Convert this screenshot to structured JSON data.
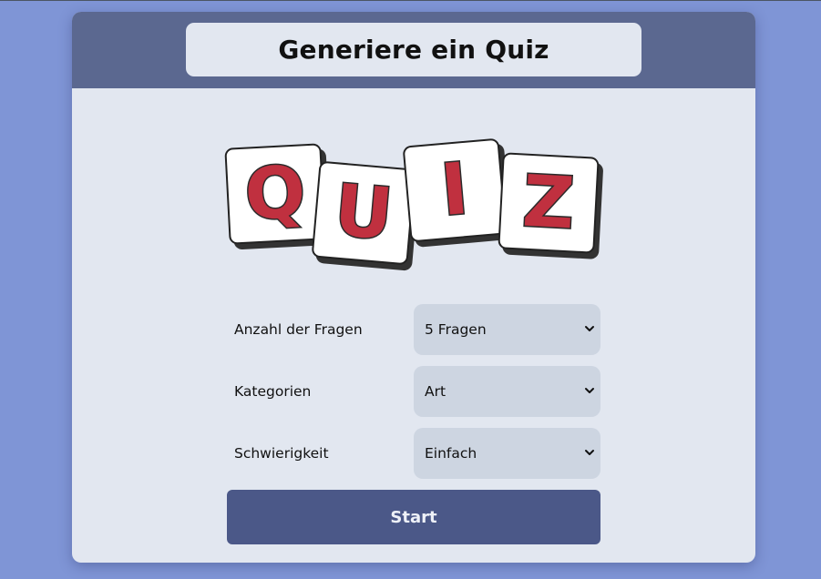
{
  "header": {
    "title": "Generiere ein Quiz"
  },
  "logo": {
    "letters": [
      "Q",
      "U",
      "I",
      "Z"
    ],
    "letter_color": "#c0303f",
    "tile_color": "#ffffff"
  },
  "form": {
    "fields": [
      {
        "label": "Anzahl der Fragen",
        "value": "5 Fragen"
      },
      {
        "label": "Kategorien",
        "value": "Art"
      },
      {
        "label": "Schwierigkeit",
        "value": "Einfach"
      }
    ],
    "start_label": "Start"
  },
  "colors": {
    "page_background": "#7f95d6",
    "header_background": "#5b6890",
    "card_background": "#e2e7f0",
    "select_background": "#cdd5e1",
    "button_background": "#4b5888"
  }
}
